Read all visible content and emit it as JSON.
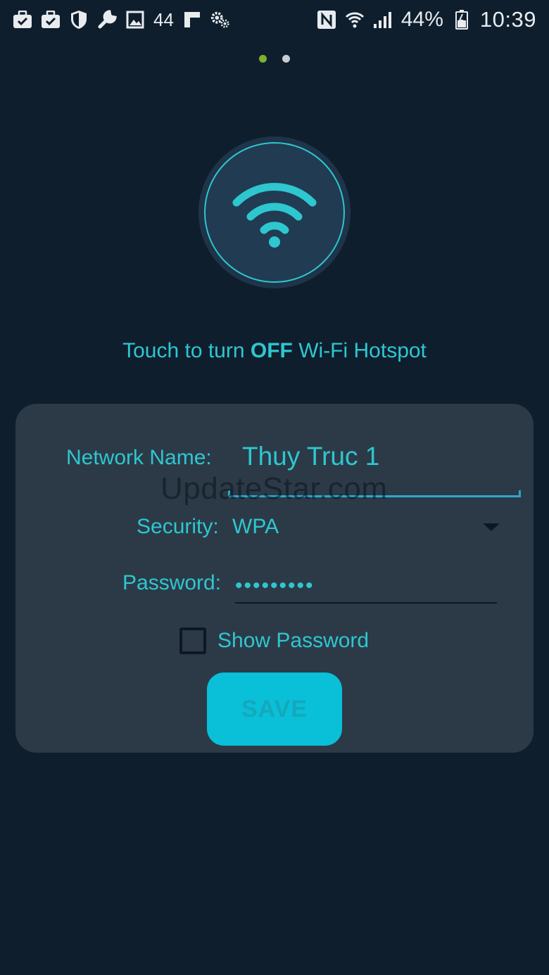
{
  "status_bar": {
    "left_icons": [
      "briefcase-check-icon",
      "briefcase-check-icon",
      "shield-icon",
      "wrench-icon",
      "image-icon"
    ],
    "notification_count": "44",
    "extra_icons": [
      "flipboard-icon",
      "gears-icon"
    ],
    "right_icons": [
      "nfc-icon",
      "wifi-icon",
      "signal-icon"
    ],
    "battery_percent": "44%",
    "time": "10:39"
  },
  "pager": {
    "active_index": 0,
    "count": 2
  },
  "hotspot": {
    "icon": "wifi-icon",
    "hint_prefix": "Touch to turn ",
    "hint_state": "OFF",
    "hint_suffix": " Wi-Fi Hotspot"
  },
  "form": {
    "network_name_label": "Network Name:",
    "network_name_value": "Thuy Truc 1",
    "watermark": "UpdateStar.com",
    "security_label": "Security:",
    "security_value": "WPA",
    "password_label": "Password:",
    "password_value": "•••••••••",
    "show_password_label": "Show Password",
    "show_password_checked": false,
    "save_label": "SAVE"
  },
  "colors": {
    "background": "#0f1e2d",
    "card": "#2c3a48",
    "accent": "#2ec7cf",
    "button": "#0abfd8",
    "pager_active": "#7bb32e"
  }
}
